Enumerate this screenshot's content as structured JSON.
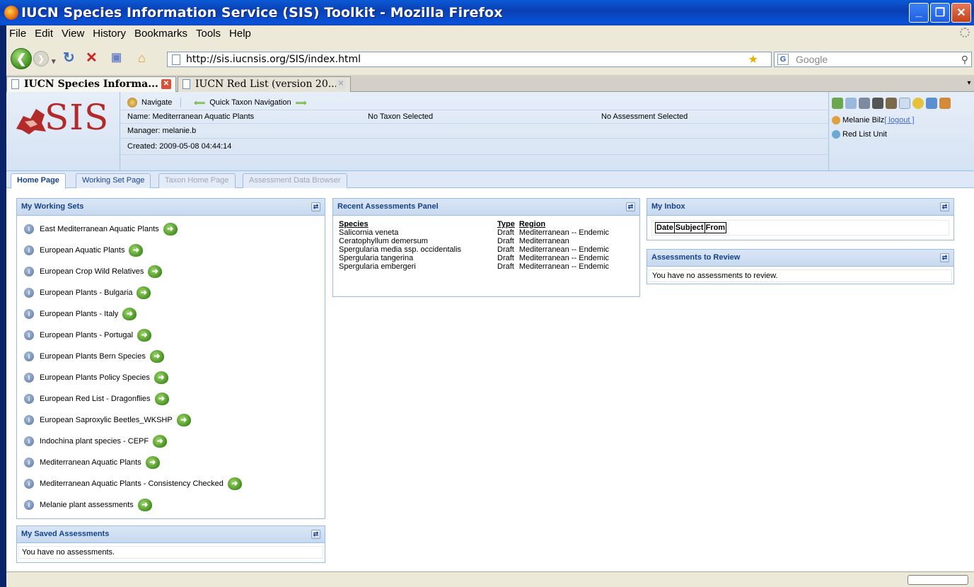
{
  "window": {
    "title": "IUCN Species Information Service (SIS) Toolkit - Mozilla Firefox",
    "buttons": {
      "minimize": "_",
      "maximize": "❐",
      "close": "✕"
    }
  },
  "menu": [
    "File",
    "Edit",
    "View",
    "History",
    "Bookmarks",
    "Tools",
    "Help"
  ],
  "navbar": {
    "url": "http://sis.iucnsis.org/SIS/index.html",
    "search_placeholder": "Google"
  },
  "browser_tabs": [
    {
      "label": "IUCN Species Informa...",
      "active": true
    },
    {
      "label": "IUCN Red List (version 20...",
      "active": false
    }
  ],
  "app": {
    "logo_text": "SIS",
    "navigate_label": "Navigate",
    "quick_nav_label": "Quick Taxon Navigation",
    "name_line": "Name: Mediterranean Aquatic Plants",
    "manager_line": "Manager: melanie.b",
    "created_line": "Created: 2009-05-08 04:44:14",
    "no_taxon": "No Taxon Selected",
    "no_assessment": "No Assessment Selected",
    "user_name": "Melanie Bilz",
    "logout_label": "[ logout ]",
    "unit_label": "Red List Unit",
    "tabs": [
      {
        "label": "Home Page",
        "state": "active"
      },
      {
        "label": "Working Set Page",
        "state": "normal"
      },
      {
        "label": "Taxon Home Page",
        "state": "disabled"
      },
      {
        "label": "Assessment Data Browser",
        "state": "disabled"
      }
    ]
  },
  "working_sets": {
    "title": "My Working Sets",
    "items": [
      "East Mediterranean Aquatic Plants",
      "European Aquatic Plants",
      "European Crop Wild Relatives",
      "European Plants - Bulgaria",
      "European Plants - Italy",
      "European Plants - Portugal",
      "European Plants Bern Species",
      "European Plants Policy Species",
      "European Red List - Dragonflies",
      "European Saproxylic Beetles_WKSHP",
      "Indochina plant species - CEPF",
      "Mediterranean Aquatic Plants",
      "Mediterranean Aquatic Plants - Consistency Checked",
      "Melanie plant assessments"
    ]
  },
  "saved_assessments": {
    "title": "My Saved Assessments",
    "empty_text": "You have no assessments."
  },
  "recent_assessments": {
    "title": "Recent Assessments Panel",
    "headers": {
      "species": "Species",
      "type": "Type",
      "region": "Region"
    },
    "rows": [
      {
        "species": "Salicornia veneta",
        "type": "Draft",
        "region": "Mediterranean -- Endemic"
      },
      {
        "species": "Ceratophyllum demersum",
        "type": "Draft",
        "region": "Mediterranean"
      },
      {
        "species": "Spergularia media ssp. occidentalis",
        "type": "Draft",
        "region": "Mediterranean -- Endemic"
      },
      {
        "species": "Spergularia tangerina",
        "type": "Draft",
        "region": "Mediterranean -- Endemic"
      },
      {
        "species": "Spergularia embergeri",
        "type": "Draft",
        "region": "Mediterranean -- Endemic"
      }
    ]
  },
  "inbox": {
    "title": "My Inbox",
    "headers": [
      "Date",
      "Subject",
      "From"
    ]
  },
  "to_review": {
    "title": "Assessments to Review",
    "empty_text": "You have no assessments to review."
  },
  "colors": {
    "panel_header": "#15428b",
    "xp_titlebar": "#0a46b9",
    "logo_red": "#b22a2a"
  }
}
